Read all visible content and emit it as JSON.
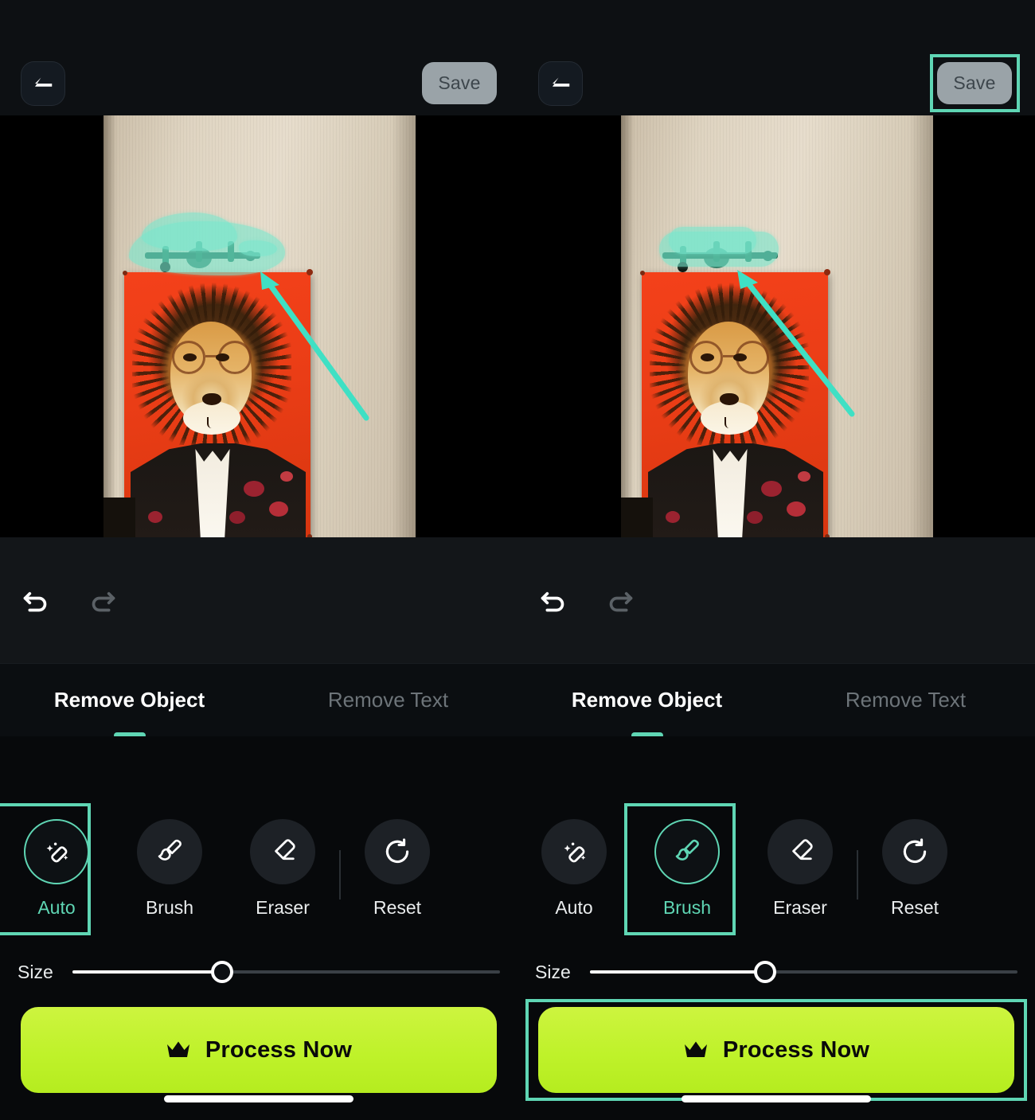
{
  "app": {
    "accent_teal": "#5fd6b4",
    "cta_green": "#bff22a",
    "panel_bg": "#0d1013",
    "mask_color": "#78e6cd"
  },
  "panels": [
    {
      "id": "left",
      "topbar": {
        "back_icon": "back-arrow-icon",
        "save_label": "Save",
        "save_highlighted": false
      },
      "canvas": {
        "photo_description": "Orange banner poster of a lion wearing glasses and a floral suit hung on a beige wall, with a coat rack mounted above it",
        "mask_shape": "auto-blob",
        "annotation_arrow": "teal-arrow-pointing-to-coat-rack"
      },
      "history": {
        "undo_label": "Undo",
        "undo_enabled": true,
        "redo_label": "Redo",
        "redo_enabled": false
      },
      "tabs": [
        {
          "label": "Remove Object",
          "active": true
        },
        {
          "label": "Remove Text",
          "active": false
        }
      ],
      "tools": [
        {
          "label": "Auto",
          "icon": "magic-wand-eraser-icon",
          "selected": true,
          "highlighted": true
        },
        {
          "label": "Brush",
          "icon": "brush-icon",
          "selected": false,
          "highlighted": false
        },
        {
          "label": "Eraser",
          "icon": "eraser-icon",
          "selected": false,
          "highlighted": false
        },
        {
          "label": "Reset",
          "icon": "reset-rotate-icon",
          "selected": false,
          "highlighted": false
        }
      ],
      "size": {
        "label": "Size",
        "value_percent": 35
      },
      "cta": {
        "label": "Process Now",
        "icon": "crown-icon",
        "highlighted": false
      }
    },
    {
      "id": "right",
      "topbar": {
        "back_icon": "back-arrow-icon",
        "save_label": "Save",
        "save_highlighted": true
      },
      "canvas": {
        "photo_description": "Orange banner poster of a lion wearing glasses and a floral suit hung on a beige wall, with a coat rack mounted above it",
        "mask_shape": "brush-stroke",
        "annotation_arrow": "teal-arrow-pointing-to-coat-rack"
      },
      "history": {
        "undo_label": "Undo",
        "undo_enabled": true,
        "redo_label": "Redo",
        "redo_enabled": false
      },
      "tabs": [
        {
          "label": "Remove Object",
          "active": true
        },
        {
          "label": "Remove Text",
          "active": false
        }
      ],
      "tools": [
        {
          "label": "Auto",
          "icon": "magic-wand-eraser-icon",
          "selected": false,
          "highlighted": false
        },
        {
          "label": "Brush",
          "icon": "brush-icon",
          "selected": true,
          "highlighted": true
        },
        {
          "label": "Eraser",
          "icon": "eraser-icon",
          "selected": false,
          "highlighted": false
        },
        {
          "label": "Reset",
          "icon": "reset-rotate-icon",
          "selected": false,
          "highlighted": false
        }
      ],
      "size": {
        "label": "Size",
        "value_percent": 41
      },
      "cta": {
        "label": "Process Now",
        "icon": "crown-icon",
        "highlighted": true
      }
    }
  ]
}
